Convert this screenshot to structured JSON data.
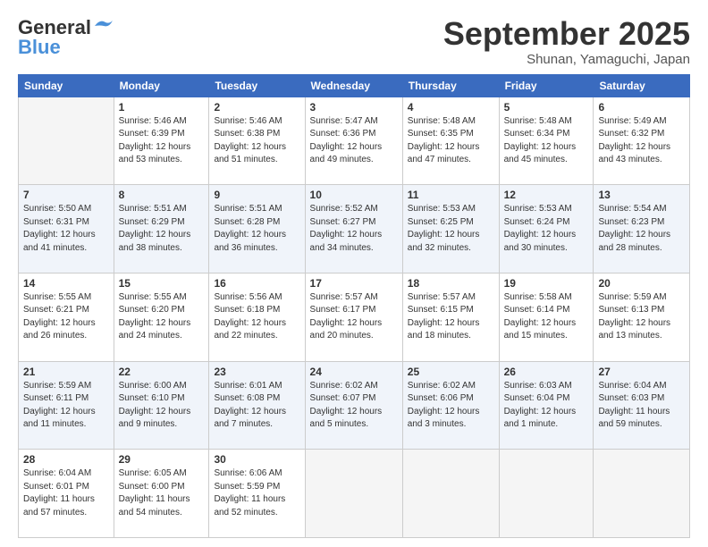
{
  "header": {
    "logo_general": "General",
    "logo_blue": "Blue",
    "month_year": "September 2025",
    "location": "Shunan, Yamaguchi, Japan"
  },
  "weekdays": [
    "Sunday",
    "Monday",
    "Tuesday",
    "Wednesday",
    "Thursday",
    "Friday",
    "Saturday"
  ],
  "weeks": [
    [
      {
        "day": "",
        "empty": true
      },
      {
        "day": "1",
        "sunrise": "Sunrise: 5:46 AM",
        "sunset": "Sunset: 6:39 PM",
        "daylight": "Daylight: 12 hours and 53 minutes."
      },
      {
        "day": "2",
        "sunrise": "Sunrise: 5:46 AM",
        "sunset": "Sunset: 6:38 PM",
        "daylight": "Daylight: 12 hours and 51 minutes."
      },
      {
        "day": "3",
        "sunrise": "Sunrise: 5:47 AM",
        "sunset": "Sunset: 6:36 PM",
        "daylight": "Daylight: 12 hours and 49 minutes."
      },
      {
        "day": "4",
        "sunrise": "Sunrise: 5:48 AM",
        "sunset": "Sunset: 6:35 PM",
        "daylight": "Daylight: 12 hours and 47 minutes."
      },
      {
        "day": "5",
        "sunrise": "Sunrise: 5:48 AM",
        "sunset": "Sunset: 6:34 PM",
        "daylight": "Daylight: 12 hours and 45 minutes."
      },
      {
        "day": "6",
        "sunrise": "Sunrise: 5:49 AM",
        "sunset": "Sunset: 6:32 PM",
        "daylight": "Daylight: 12 hours and 43 minutes."
      }
    ],
    [
      {
        "day": "7",
        "sunrise": "Sunrise: 5:50 AM",
        "sunset": "Sunset: 6:31 PM",
        "daylight": "Daylight: 12 hours and 41 minutes."
      },
      {
        "day": "8",
        "sunrise": "Sunrise: 5:51 AM",
        "sunset": "Sunset: 6:29 PM",
        "daylight": "Daylight: 12 hours and 38 minutes."
      },
      {
        "day": "9",
        "sunrise": "Sunrise: 5:51 AM",
        "sunset": "Sunset: 6:28 PM",
        "daylight": "Daylight: 12 hours and 36 minutes."
      },
      {
        "day": "10",
        "sunrise": "Sunrise: 5:52 AM",
        "sunset": "Sunset: 6:27 PM",
        "daylight": "Daylight: 12 hours and 34 minutes."
      },
      {
        "day": "11",
        "sunrise": "Sunrise: 5:53 AM",
        "sunset": "Sunset: 6:25 PM",
        "daylight": "Daylight: 12 hours and 32 minutes."
      },
      {
        "day": "12",
        "sunrise": "Sunrise: 5:53 AM",
        "sunset": "Sunset: 6:24 PM",
        "daylight": "Daylight: 12 hours and 30 minutes."
      },
      {
        "day": "13",
        "sunrise": "Sunrise: 5:54 AM",
        "sunset": "Sunset: 6:23 PM",
        "daylight": "Daylight: 12 hours and 28 minutes."
      }
    ],
    [
      {
        "day": "14",
        "sunrise": "Sunrise: 5:55 AM",
        "sunset": "Sunset: 6:21 PM",
        "daylight": "Daylight: 12 hours and 26 minutes."
      },
      {
        "day": "15",
        "sunrise": "Sunrise: 5:55 AM",
        "sunset": "Sunset: 6:20 PM",
        "daylight": "Daylight: 12 hours and 24 minutes."
      },
      {
        "day": "16",
        "sunrise": "Sunrise: 5:56 AM",
        "sunset": "Sunset: 6:18 PM",
        "daylight": "Daylight: 12 hours and 22 minutes."
      },
      {
        "day": "17",
        "sunrise": "Sunrise: 5:57 AM",
        "sunset": "Sunset: 6:17 PM",
        "daylight": "Daylight: 12 hours and 20 minutes."
      },
      {
        "day": "18",
        "sunrise": "Sunrise: 5:57 AM",
        "sunset": "Sunset: 6:15 PM",
        "daylight": "Daylight: 12 hours and 18 minutes."
      },
      {
        "day": "19",
        "sunrise": "Sunrise: 5:58 AM",
        "sunset": "Sunset: 6:14 PM",
        "daylight": "Daylight: 12 hours and 15 minutes."
      },
      {
        "day": "20",
        "sunrise": "Sunrise: 5:59 AM",
        "sunset": "Sunset: 6:13 PM",
        "daylight": "Daylight: 12 hours and 13 minutes."
      }
    ],
    [
      {
        "day": "21",
        "sunrise": "Sunrise: 5:59 AM",
        "sunset": "Sunset: 6:11 PM",
        "daylight": "Daylight: 12 hours and 11 minutes."
      },
      {
        "day": "22",
        "sunrise": "Sunrise: 6:00 AM",
        "sunset": "Sunset: 6:10 PM",
        "daylight": "Daylight: 12 hours and 9 minutes."
      },
      {
        "day": "23",
        "sunrise": "Sunrise: 6:01 AM",
        "sunset": "Sunset: 6:08 PM",
        "daylight": "Daylight: 12 hours and 7 minutes."
      },
      {
        "day": "24",
        "sunrise": "Sunrise: 6:02 AM",
        "sunset": "Sunset: 6:07 PM",
        "daylight": "Daylight: 12 hours and 5 minutes."
      },
      {
        "day": "25",
        "sunrise": "Sunrise: 6:02 AM",
        "sunset": "Sunset: 6:06 PM",
        "daylight": "Daylight: 12 hours and 3 minutes."
      },
      {
        "day": "26",
        "sunrise": "Sunrise: 6:03 AM",
        "sunset": "Sunset: 6:04 PM",
        "daylight": "Daylight: 12 hours and 1 minute."
      },
      {
        "day": "27",
        "sunrise": "Sunrise: 6:04 AM",
        "sunset": "Sunset: 6:03 PM",
        "daylight": "Daylight: 11 hours and 59 minutes."
      }
    ],
    [
      {
        "day": "28",
        "sunrise": "Sunrise: 6:04 AM",
        "sunset": "Sunset: 6:01 PM",
        "daylight": "Daylight: 11 hours and 57 minutes."
      },
      {
        "day": "29",
        "sunrise": "Sunrise: 6:05 AM",
        "sunset": "Sunset: 6:00 PM",
        "daylight": "Daylight: 11 hours and 54 minutes."
      },
      {
        "day": "30",
        "sunrise": "Sunrise: 6:06 AM",
        "sunset": "Sunset: 5:59 PM",
        "daylight": "Daylight: 11 hours and 52 minutes."
      },
      {
        "day": "",
        "empty": true
      },
      {
        "day": "",
        "empty": true
      },
      {
        "day": "",
        "empty": true
      },
      {
        "day": "",
        "empty": true
      }
    ]
  ]
}
